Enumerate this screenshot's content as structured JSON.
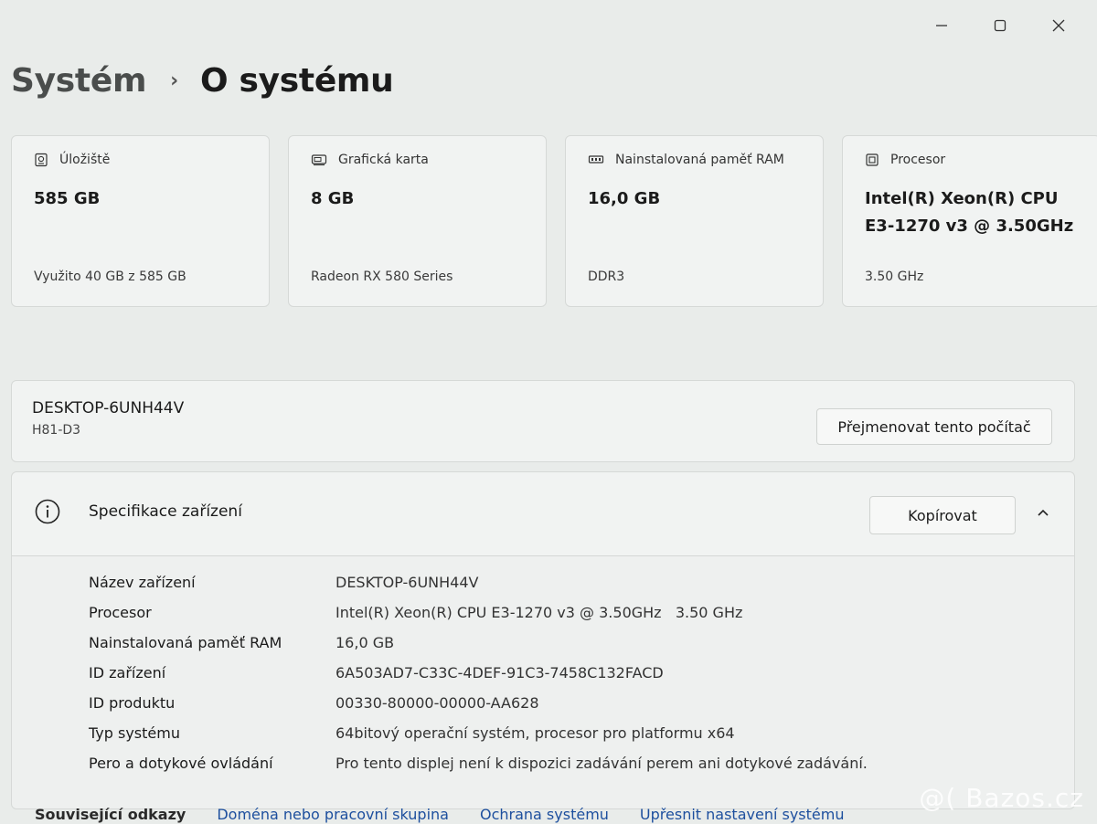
{
  "window": {
    "minimize_icon": "minimize-icon",
    "maximize_icon": "maximize-icon",
    "close_icon": "close-icon"
  },
  "breadcrumb": {
    "parent": "Systém",
    "separator": "›",
    "current": "O systému"
  },
  "cards": [
    {
      "icon": "storage-icon",
      "label": "Úložiště",
      "value": "585 GB",
      "sub": "Využito 40 GB z 585 GB"
    },
    {
      "icon": "gpu-icon",
      "label": "Grafická karta",
      "value": "8 GB",
      "sub": "Radeon RX 580 Series"
    },
    {
      "icon": "ram-icon",
      "label": "Nainstalovaná paměť RAM",
      "value": "16,0 GB",
      "sub": "DDR3"
    },
    {
      "icon": "processor-icon",
      "label": "Procesor",
      "value": "Intel(R) Xeon(R) CPU E3-1270 v3 @ 3.50GHz",
      "sub": "3.50 GHz"
    }
  ],
  "device": {
    "name": "DESKTOP-6UNH44V",
    "model": "H81-D3",
    "rename_label": "Přejmenovat tento počítač"
  },
  "specs": {
    "title": "Specifikace zařízení",
    "copy_label": "Kopírovat",
    "rows": [
      {
        "label": "Název zařízení",
        "value": "DESKTOP-6UNH44V"
      },
      {
        "label": "Procesor",
        "value": "Intel(R) Xeon(R) CPU E3-1270 v3 @ 3.50GHz   3.50 GHz"
      },
      {
        "label": "Nainstalovaná paměť RAM",
        "value": "16,0 GB"
      },
      {
        "label": "ID zařízení",
        "value": "6A503AD7-C33C-4DEF-91C3-7458C132FACD"
      },
      {
        "label": "ID produktu",
        "value": "00330-80000-00000-AA628"
      },
      {
        "label": "Typ systému",
        "value": "64bitový operační systém, procesor pro platformu x64"
      },
      {
        "label": "Pero a dotykové ovládání",
        "value": "Pro tento displej není k dispozici zadávání perem ani dotykové zadávání."
      }
    ]
  },
  "related_links": {
    "heading": "Související odkazy",
    "links": [
      "Doména nebo pracovní skupina",
      "Ochrana systému",
      "Upřesnit nastavení systému"
    ]
  },
  "watermark": "@( Bazos.cz"
}
